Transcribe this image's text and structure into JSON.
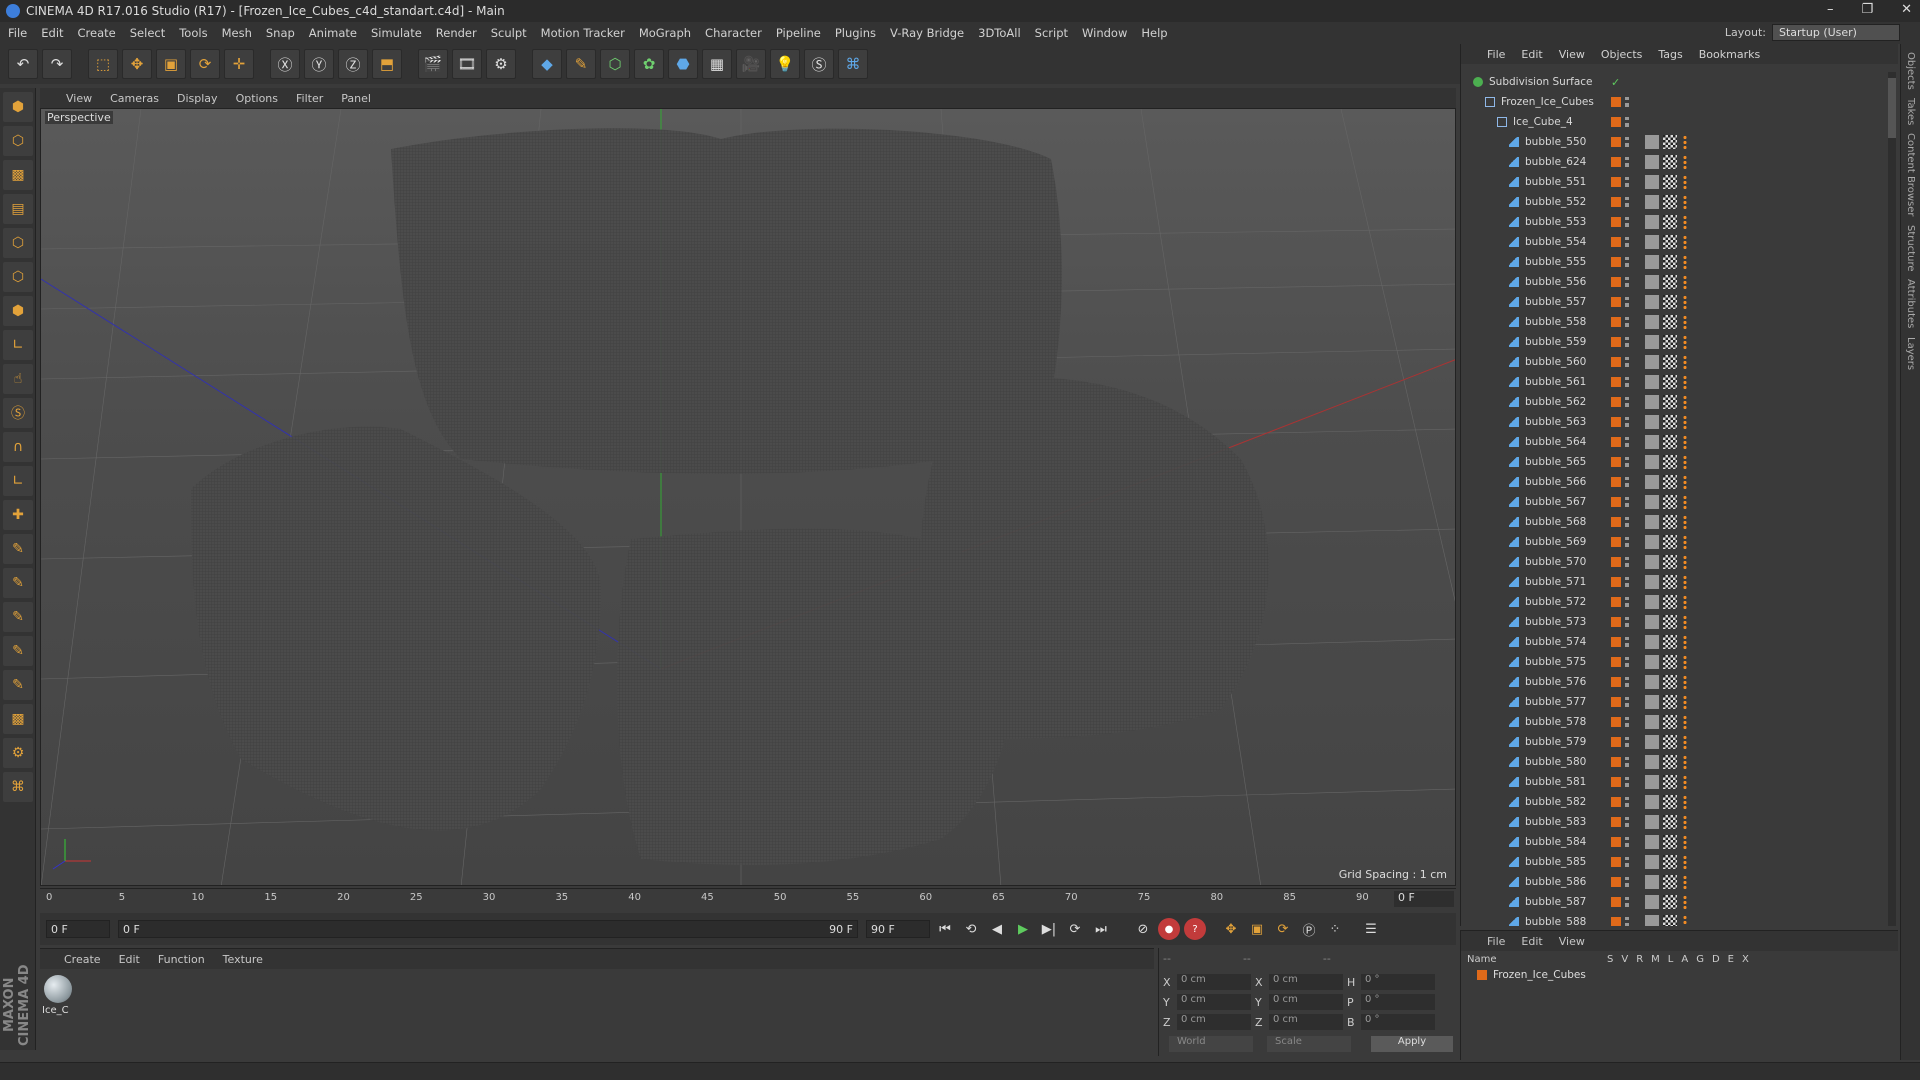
{
  "window": {
    "title": "CINEMA 4D R17.016 Studio (R17) - [Frozen_Ice_Cubes_c4d_standart.c4d] - Main"
  },
  "menubar": [
    "File",
    "Edit",
    "Create",
    "Select",
    "Tools",
    "Mesh",
    "Snap",
    "Animate",
    "Simulate",
    "Render",
    "Sculpt",
    "Motion Tracker",
    "MoGraph",
    "Character",
    "Pipeline",
    "Plugins",
    "V-Ray Bridge",
    "3DToAll",
    "Script",
    "Window",
    "Help"
  ],
  "layout": {
    "label": "Layout:",
    "value": "Startup (User)"
  },
  "viewport": {
    "menu": [
      "View",
      "Cameras",
      "Display",
      "Options",
      "Filter",
      "Panel"
    ],
    "label": "Perspective",
    "grid_spacing": "Grid Spacing : 1 cm"
  },
  "timeline": {
    "ticks": [
      "0",
      "5",
      "10",
      "15",
      "20",
      "25",
      "30",
      "35",
      "40",
      "45",
      "50",
      "55",
      "60",
      "65",
      "70",
      "75",
      "80",
      "85",
      "90"
    ],
    "current_frame": "0 F"
  },
  "transport": {
    "start": "0 F",
    "range_start": "0 F",
    "range_end": "90 F",
    "end": "90 F"
  },
  "material": {
    "menu": [
      "Create",
      "Edit",
      "Function",
      "Texture"
    ],
    "name": "Ice_C"
  },
  "coords": {
    "pos": {
      "x": "0 cm",
      "y": "0 cm",
      "z": "0 cm"
    },
    "size": {
      "x": "0 cm",
      "y": "0 cm",
      "z": "0 cm"
    },
    "rot": {
      "h": "0 °",
      "p": "0 °",
      "b": "0 °"
    },
    "mode1": "World",
    "mode2": "Scale",
    "apply": "Apply",
    "col1": "--",
    "col2": "--",
    "col3": "--"
  },
  "objects": {
    "menu": [
      "File",
      "Edit",
      "View",
      "Objects",
      "Tags",
      "Bookmarks"
    ],
    "rows": [
      {
        "name": "Subdivision Surface",
        "depth": 0
      },
      {
        "name": "Frozen_Ice_Cubes",
        "depth": 1
      },
      {
        "name": "Ice_Cube_4",
        "depth": 2
      },
      {
        "name": "bubble_550",
        "depth": 3
      },
      {
        "name": "bubble_624",
        "depth": 3
      },
      {
        "name": "bubble_551",
        "depth": 3
      },
      {
        "name": "bubble_552",
        "depth": 3
      },
      {
        "name": "bubble_553",
        "depth": 3
      },
      {
        "name": "bubble_554",
        "depth": 3
      },
      {
        "name": "bubble_555",
        "depth": 3
      },
      {
        "name": "bubble_556",
        "depth": 3
      },
      {
        "name": "bubble_557",
        "depth": 3
      },
      {
        "name": "bubble_558",
        "depth": 3
      },
      {
        "name": "bubble_559",
        "depth": 3
      },
      {
        "name": "bubble_560",
        "depth": 3
      },
      {
        "name": "bubble_561",
        "depth": 3
      },
      {
        "name": "bubble_562",
        "depth": 3
      },
      {
        "name": "bubble_563",
        "depth": 3
      },
      {
        "name": "bubble_564",
        "depth": 3
      },
      {
        "name": "bubble_565",
        "depth": 3
      },
      {
        "name": "bubble_566",
        "depth": 3
      },
      {
        "name": "bubble_567",
        "depth": 3
      },
      {
        "name": "bubble_568",
        "depth": 3
      },
      {
        "name": "bubble_569",
        "depth": 3
      },
      {
        "name": "bubble_570",
        "depth": 3
      },
      {
        "name": "bubble_571",
        "depth": 3
      },
      {
        "name": "bubble_572",
        "depth": 3
      },
      {
        "name": "bubble_573",
        "depth": 3
      },
      {
        "name": "bubble_574",
        "depth": 3
      },
      {
        "name": "bubble_575",
        "depth": 3
      },
      {
        "name": "bubble_576",
        "depth": 3
      },
      {
        "name": "bubble_577",
        "depth": 3
      },
      {
        "name": "bubble_578",
        "depth": 3
      },
      {
        "name": "bubble_579",
        "depth": 3
      },
      {
        "name": "bubble_580",
        "depth": 3
      },
      {
        "name": "bubble_581",
        "depth": 3
      },
      {
        "name": "bubble_582",
        "depth": 3
      },
      {
        "name": "bubble_583",
        "depth": 3
      },
      {
        "name": "bubble_584",
        "depth": 3
      },
      {
        "name": "bubble_585",
        "depth": 3
      },
      {
        "name": "bubble_586",
        "depth": 3
      },
      {
        "name": "bubble_587",
        "depth": 3
      },
      {
        "name": "bubble_588",
        "depth": 3
      }
    ]
  },
  "layers": {
    "menu": [
      "File",
      "Edit",
      "View"
    ],
    "header": {
      "name": "Name",
      "cols": [
        "S",
        "V",
        "R",
        "M",
        "L",
        "A",
        "G",
        "D",
        "E",
        "X"
      ]
    },
    "row": "Frozen_Ice_Cubes"
  },
  "sidetabs": [
    "Objects",
    "Takes",
    "Content Browser",
    "Structure",
    "Attributes",
    "Layers"
  ],
  "maxon": "MAXON CINEMA 4D",
  "colors": {
    "accent": "#e06a1a",
    "x_axis": "#c23b3b",
    "y_axis": "#3fae3f",
    "z_axis": "#3b3bc2"
  }
}
